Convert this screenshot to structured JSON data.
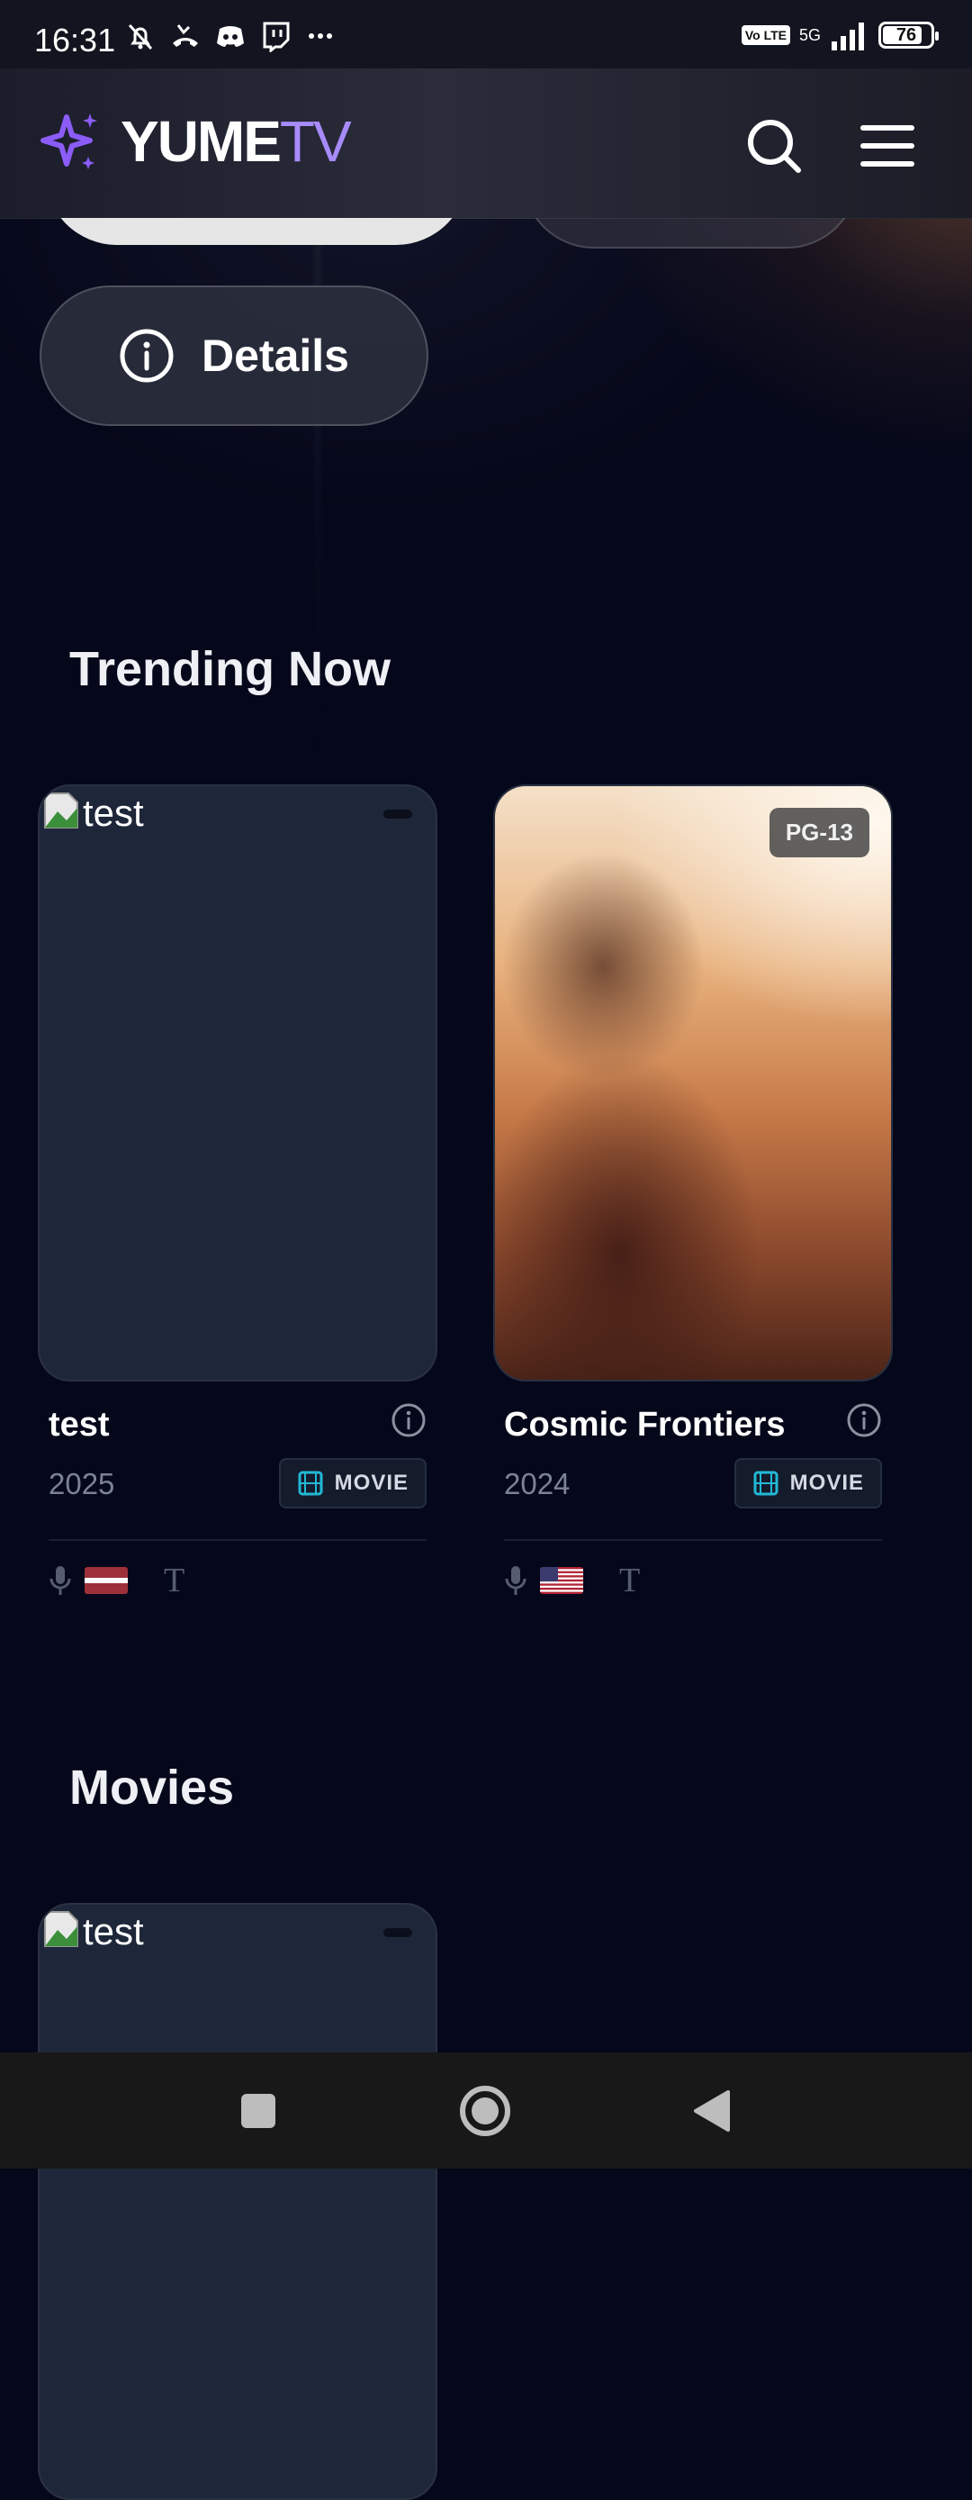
{
  "status_bar": {
    "time": "16:31",
    "network": "5G",
    "volte": "Vo LTE",
    "battery": "76",
    "icons": [
      "bell-off-icon",
      "missed-call-icon",
      "discord-icon",
      "twitch-icon",
      "more-dots-icon",
      "signal-icon",
      "battery-icon"
    ]
  },
  "header": {
    "logo_main": "YUME",
    "logo_accent": "TV",
    "accent_color": "#a78bfa",
    "icons": [
      "sparkle-logo-icon",
      "search-icon",
      "menu-icon"
    ]
  },
  "hero": {
    "details_label": "Details"
  },
  "sections": {
    "trending": {
      "title": "Trending Now",
      "items": [
        {
          "title": "test",
          "year": "2025",
          "type": "MOVIE",
          "image_alt": "test",
          "rating": "",
          "audio_flag": "Latvia"
        },
        {
          "title": "Cosmic Frontiers",
          "year": "2024",
          "type": "MOVIE",
          "image_alt": "",
          "rating": "PG-13",
          "audio_flag": "United States"
        }
      ]
    },
    "movies": {
      "title": "Movies",
      "items": [
        {
          "image_alt": "test"
        }
      ]
    }
  },
  "nav_bar": {
    "icons": [
      "recents-square-icon",
      "home-circle-icon",
      "back-triangle-icon"
    ]
  }
}
